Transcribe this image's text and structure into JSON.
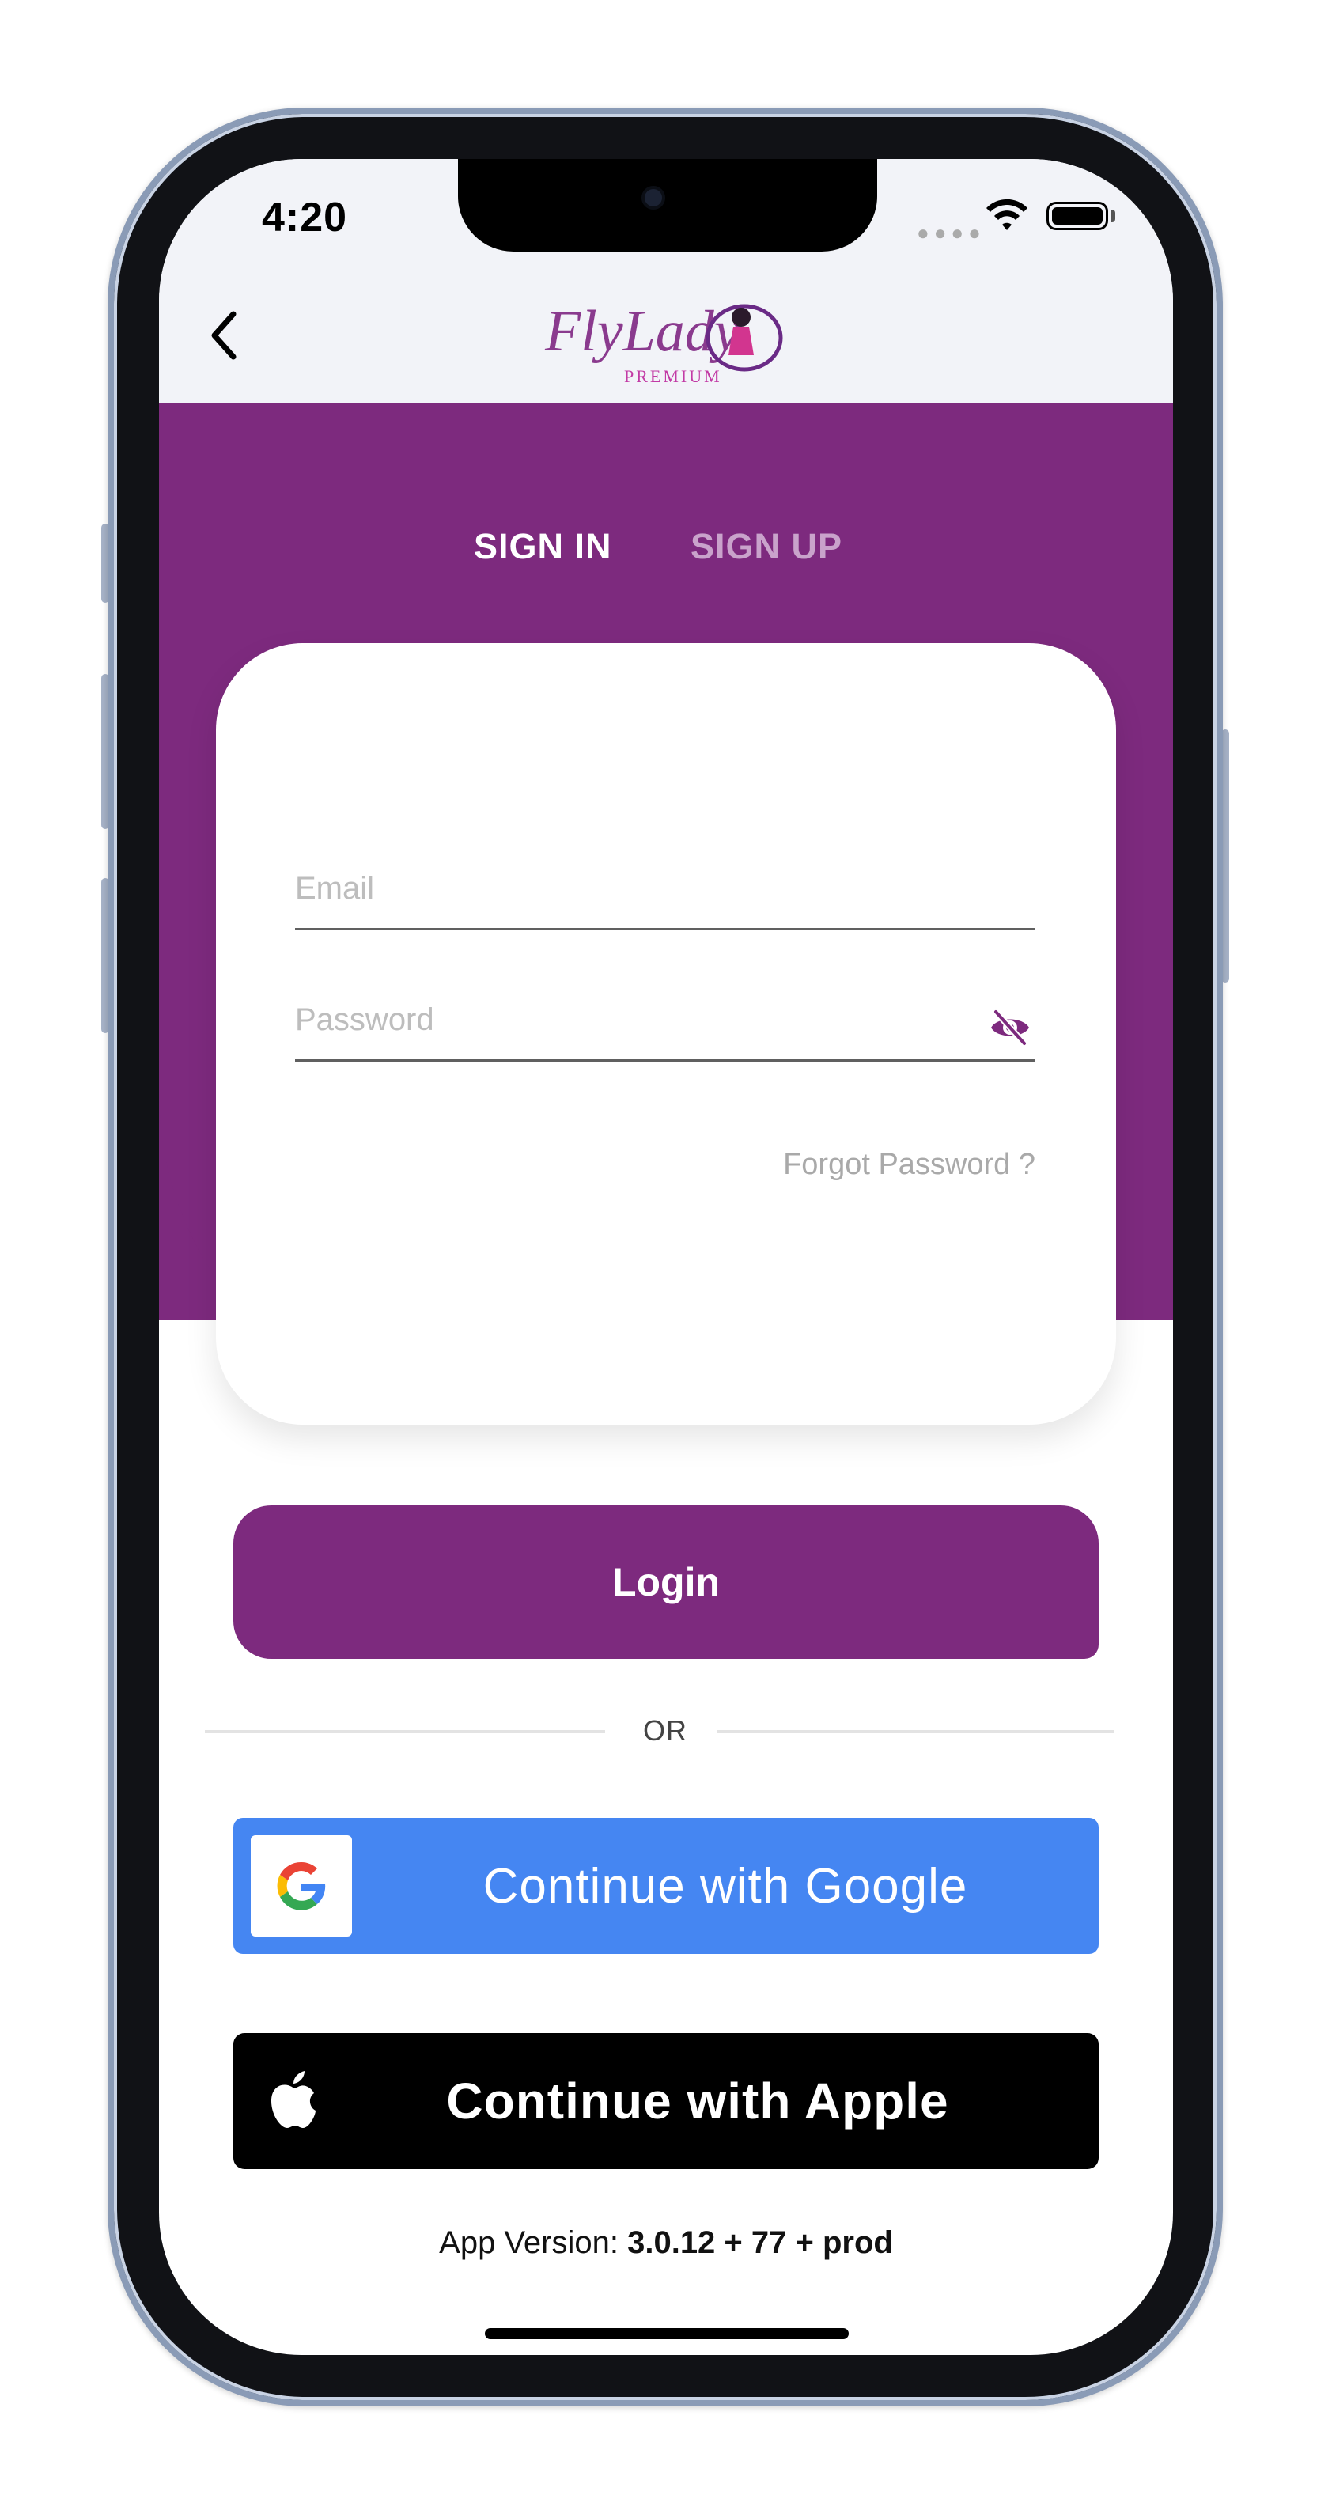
{
  "status_bar": {
    "time": "4:20"
  },
  "header": {
    "logo_text": "FlyLady",
    "logo_subtext": "PREMIUM"
  },
  "auth_tabs": [
    {
      "label": "SIGN IN",
      "active": true
    },
    {
      "label": "SIGN UP",
      "active": false
    }
  ],
  "form": {
    "email": {
      "value": "",
      "placeholder": "Email"
    },
    "password": {
      "value": "",
      "placeholder": "Password"
    },
    "forgot_label": "Forgot Password ?"
  },
  "actions": {
    "login_label": "Login",
    "divider_label": "OR",
    "google_label": "Continue with Google",
    "apple_label": "Continue with Apple"
  },
  "footer": {
    "version_prefix": "App Version: ",
    "version_value": "3.0.12 + 77 + prod"
  },
  "colors": {
    "brand_purple": "#7d2a7e",
    "tab_inactive": "#c9a3cb",
    "google_blue": "#4586f2",
    "apple_black": "#000000"
  },
  "icons": [
    "back-chevron-icon",
    "eye-slash-icon",
    "google-g-icon",
    "apple-logo-icon",
    "wifi-icon",
    "battery-icon"
  ]
}
